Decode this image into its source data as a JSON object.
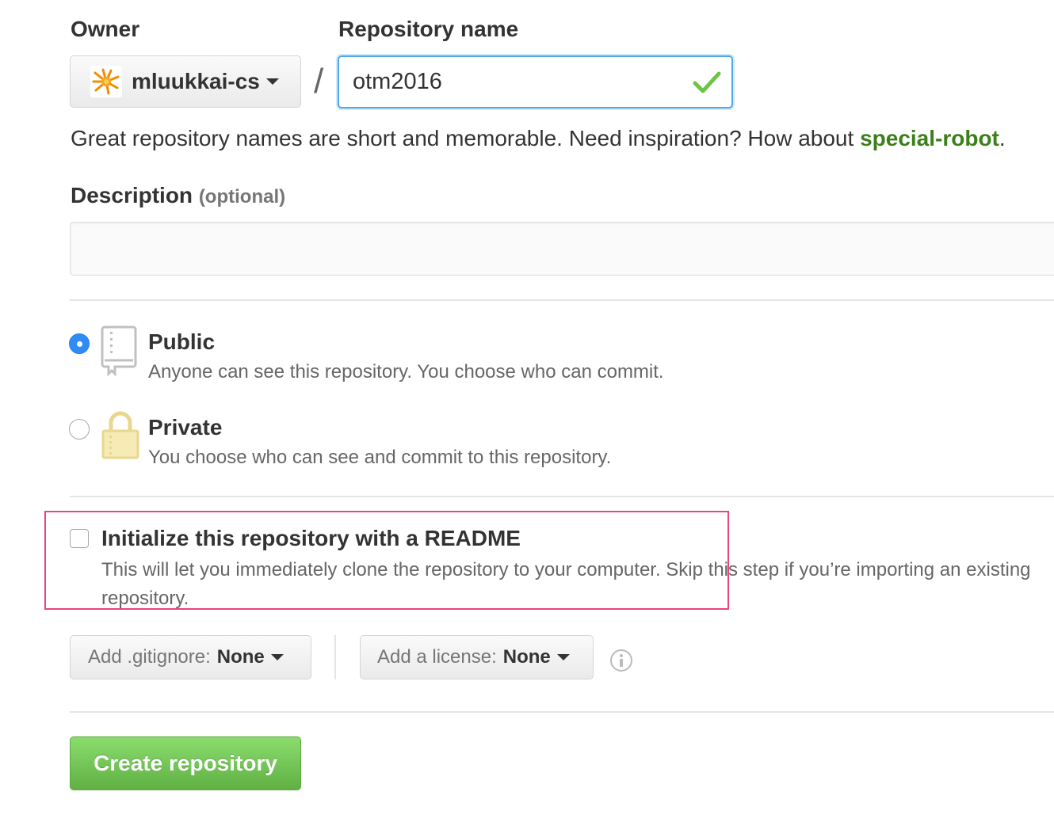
{
  "owner": {
    "label": "Owner",
    "value": "mluukkai-cs",
    "avatar_icon": "helsinki-flame-logo"
  },
  "repository": {
    "label": "Repository name",
    "value": "otm2016",
    "separator": "/",
    "valid_icon": "check-icon"
  },
  "hint": {
    "text": "Great repository names are short and memorable. Need inspiration? How about ",
    "suggestion": "special-robot",
    "suffix": "."
  },
  "description": {
    "label": "Description",
    "optional": "(optional)",
    "value": "",
    "placeholder": ""
  },
  "visibility": {
    "selected": "public",
    "public": {
      "title": "Public",
      "desc": "Anyone can see this repository. You choose who can commit.",
      "icon": "repo-book-icon"
    },
    "private": {
      "title": "Private",
      "desc": "You choose who can see and commit to this repository.",
      "icon": "lock-icon"
    }
  },
  "readme": {
    "checked": false,
    "title": "Initialize this repository with a README",
    "desc": "This will let you immediately clone the repository to your computer. Skip this step if you’re importing an existing repository."
  },
  "gitignore": {
    "prefix": "Add .gitignore:",
    "value": "None"
  },
  "license": {
    "prefix": "Add a license:",
    "value": "None"
  },
  "submit": {
    "label": "Create repository"
  },
  "colors": {
    "accent_blue": "#51a7e8",
    "radio_blue": "#2f8cf5",
    "suggestion_green": "#3c8019",
    "create_green": "#60b044",
    "highlight_pink": "#e8447d",
    "lock_yellow": "#e8d78f"
  }
}
